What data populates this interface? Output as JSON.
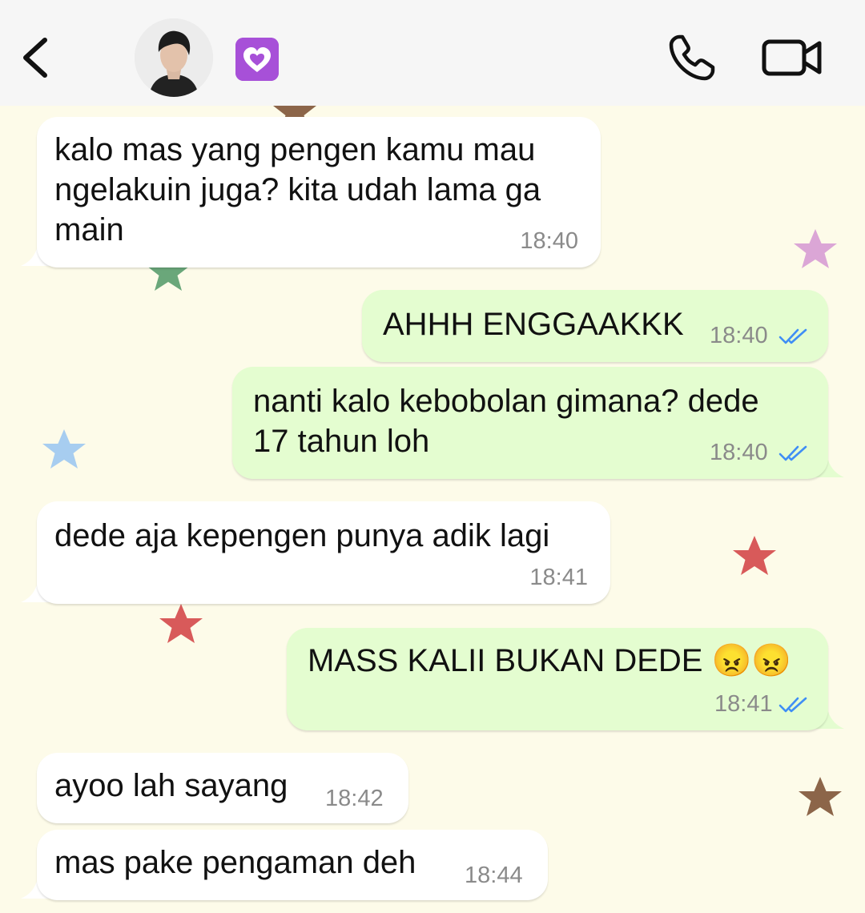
{
  "header": {
    "contact_name": "💟",
    "icons": {
      "back": "chevron-left-icon",
      "call": "phone-icon",
      "video": "video-camera-icon"
    }
  },
  "messages": [
    {
      "direction": "incoming",
      "text": "kalo mas yang pengen kamu mau\nngelakuin juga? kita udah lama ga\nmain",
      "time": "18:40"
    },
    {
      "direction": "outgoing",
      "text": "AHHH ENGGAAKKK",
      "time": "18:40",
      "status": "read"
    },
    {
      "direction": "outgoing",
      "text": "nanti kalo kebobolan gimana? dede\n17 tahun loh",
      "time": "18:40",
      "status": "read"
    },
    {
      "direction": "incoming",
      "text": "dede aja kepengen punya adik lagi",
      "time": "18:41"
    },
    {
      "direction": "outgoing",
      "text": "MASS KALII BUKAN DEDE 😠😠",
      "time": "18:41",
      "status": "read"
    },
    {
      "direction": "incoming",
      "text": "ayoo lah sayang",
      "time": "18:42"
    },
    {
      "direction": "incoming",
      "text": "mas pake pengaman deh",
      "time": "18:44"
    }
  ],
  "colors": {
    "background": "#fdfbe9",
    "incoming_bubble": "#ffffff",
    "outgoing_bubble": "#e4fdd0",
    "read_ticks": "#3f8ef5"
  }
}
